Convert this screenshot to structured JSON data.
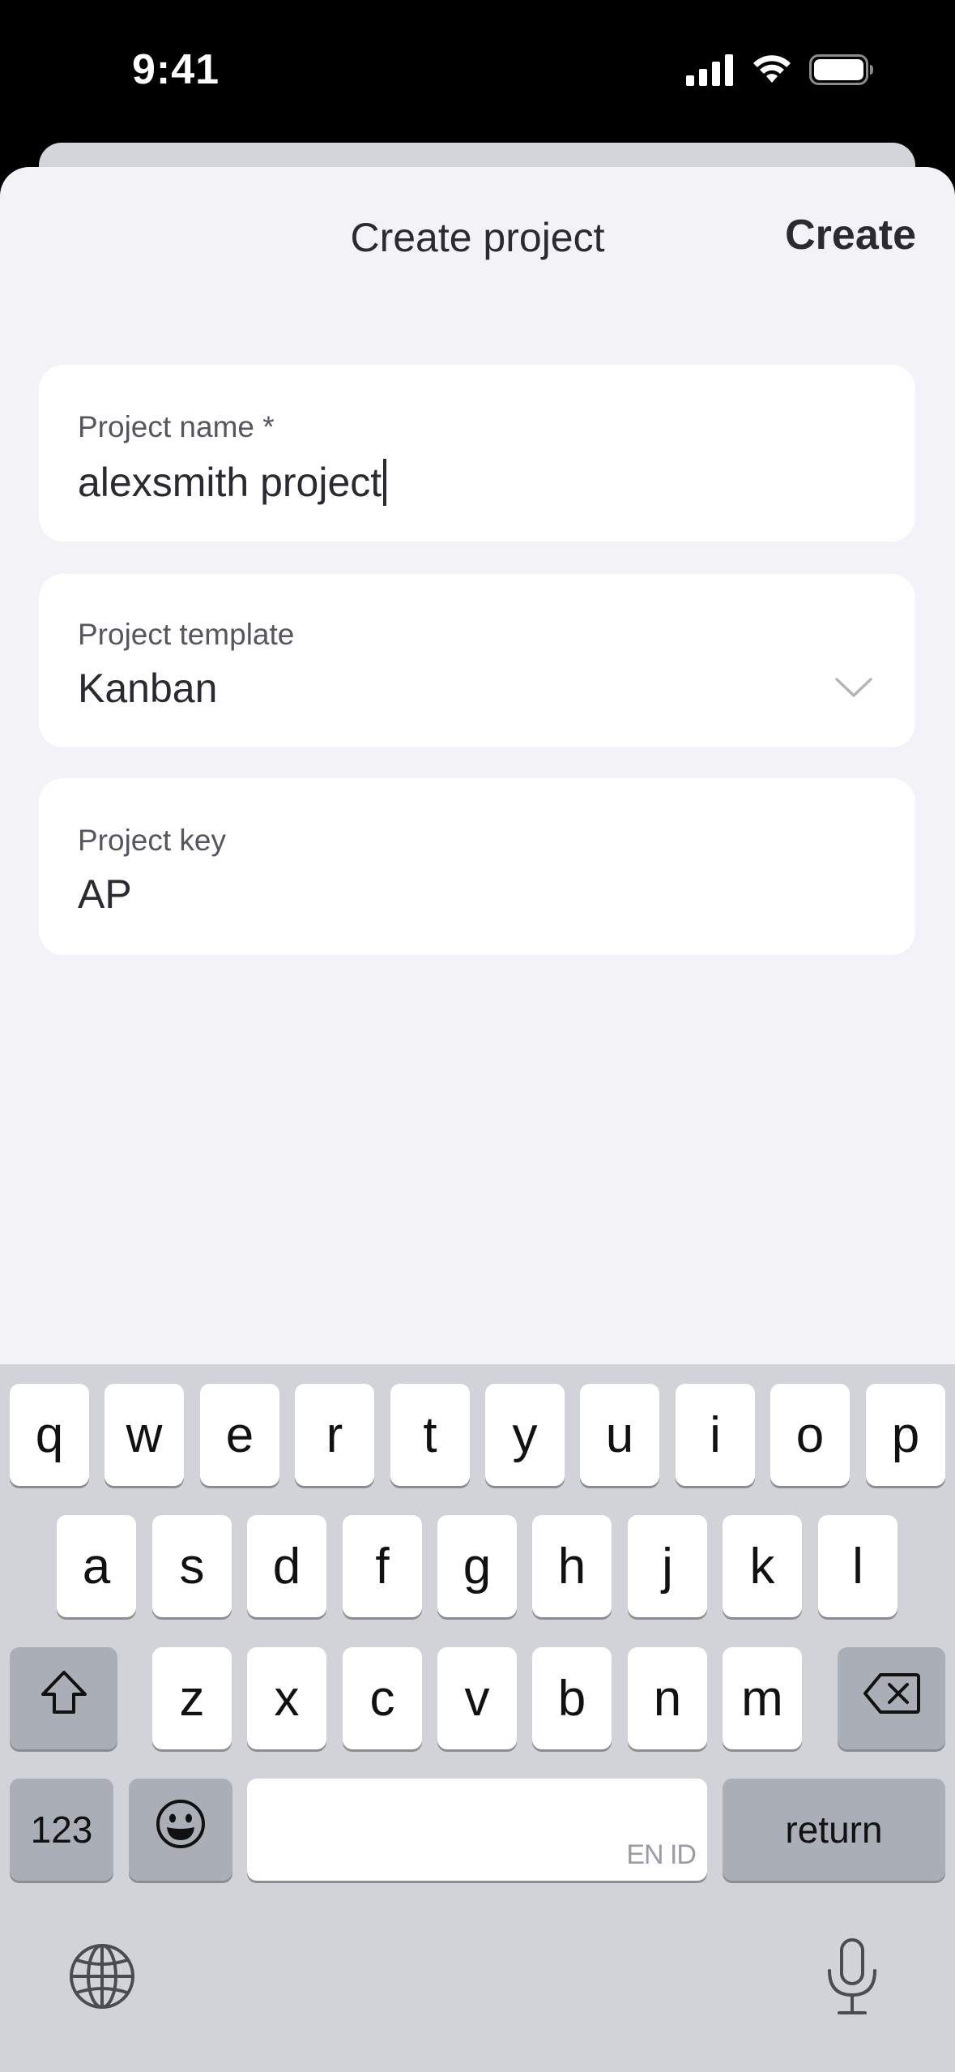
{
  "status_bar": {
    "time": "9:41"
  },
  "header": {
    "title": "Create project",
    "create_label": "Create"
  },
  "form": {
    "project_name": {
      "label": "Project name *",
      "value": "alexsmith project"
    },
    "project_template": {
      "label": "Project template",
      "value": "Kanban"
    },
    "project_key": {
      "label": "Project key",
      "value": "AP"
    }
  },
  "keyboard": {
    "row1": [
      "q",
      "w",
      "e",
      "r",
      "t",
      "y",
      "u",
      "i",
      "o",
      "p"
    ],
    "row2": [
      "a",
      "s",
      "d",
      "f",
      "g",
      "h",
      "j",
      "k",
      "l"
    ],
    "row3": [
      "z",
      "x",
      "c",
      "v",
      "b",
      "n",
      "m"
    ],
    "numbers_label": "123",
    "return_label": "return",
    "space_language": "EN ID"
  },
  "icons": {
    "signal": "cellular-signal-icon",
    "wifi": "wifi-icon",
    "battery": "battery-icon",
    "chevron": "chevron-down-icon",
    "shift": "shift-icon",
    "backspace": "backspace-icon",
    "emoji": "emoji-icon",
    "globe": "globe-icon",
    "mic": "microphone-icon"
  }
}
